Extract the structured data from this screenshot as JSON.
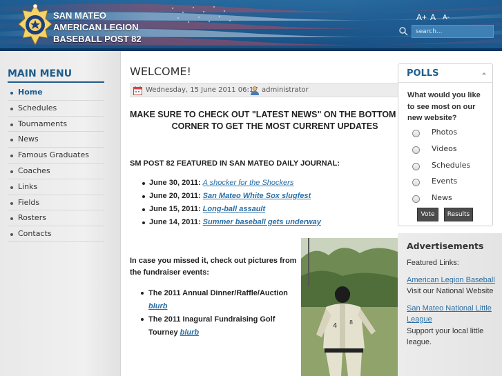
{
  "header": {
    "title_lines": [
      "SAN MATEO",
      "AMERICAN LEGION",
      "BASEBALL POST 82"
    ],
    "font_sizes": [
      "A+",
      "A",
      "A-"
    ],
    "search_placeholder": "search...",
    "logo_icon": "american-legion-emblem"
  },
  "sidebar": {
    "title": "MAIN MENU",
    "items": [
      "Home",
      "Schedules",
      "Tournaments",
      "News",
      "Famous Graduates",
      "Coaches",
      "Links",
      "Fields",
      "Rosters",
      "Contacts"
    ],
    "active": "Home"
  },
  "article": {
    "title": "WELCOME!",
    "date": "Wednesday, 15 June 2011 06:17",
    "author": "administrator",
    "announcement": [
      "MAKE SURE TO CHECK OUT \"LATEST NEWS\" ON THE BOTTOM LEFT",
      "CORNER TO GET THE MOST CURRENT UPDATES"
    ],
    "featured_heading": "SM POST 82 FEATURED IN SAN MATEO DAILY JOURNAL:",
    "news": [
      {
        "date": "June 30, 2011:",
        "link": "A shocker for the Shockers",
        "bold": false
      },
      {
        "date": "June 20, 2011:",
        "link": "San Mateo White Sox slugfest",
        "bold": true
      },
      {
        "date": "June 15, 2011:",
        "link": "Long-ball assault",
        "bold": true
      },
      {
        "date": "June 14, 2011:",
        "link": "Summer baseball gets underway",
        "bold": true
      }
    ],
    "fundraiser_intro": "In case you missed it, check out pictures from the fundraiser events:",
    "fundraisers": [
      {
        "text": "The 2011 Annual Dinner/Raffle/Auction",
        "link": "blurb"
      },
      {
        "text": "The 2011 Inagural Fundraising Golf Tourney",
        "link": "blurb"
      }
    ]
  },
  "polls": {
    "title": "POLLS",
    "question": "What would you like to see most on our new website?",
    "options": [
      "Photos",
      "Videos",
      "Schedules",
      "Events",
      "News"
    ],
    "vote_label": "Vote",
    "results_label": "Results"
  },
  "ads": {
    "title": "Advertisements",
    "featured_label": "Featured Links:",
    "links": [
      {
        "name": "American Legion Baseball",
        "desc": "Visit our National Website"
      },
      {
        "name": "San Mateo National Little League",
        "desc": "Support your local little league."
      }
    ]
  },
  "colors": {
    "header_blue": "#1f5c92",
    "menu_blue": "#1d5d8c",
    "link_blue": "#2a6fa6"
  }
}
